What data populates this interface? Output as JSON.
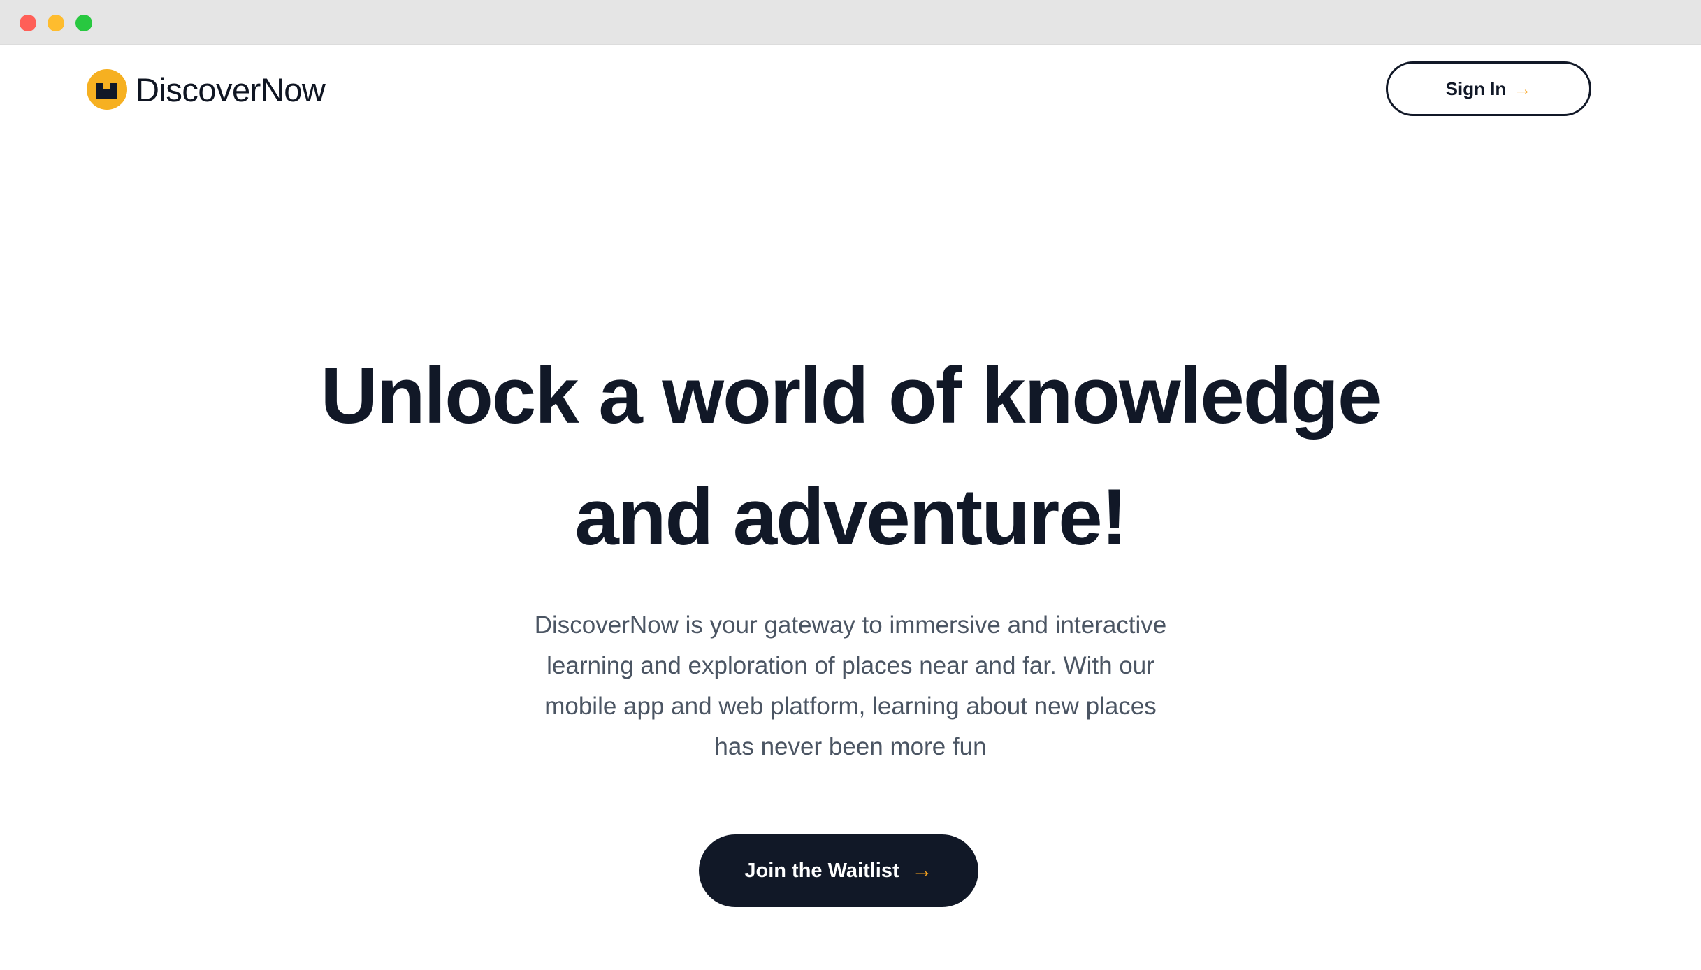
{
  "window": {
    "controls": [
      "close",
      "minimize",
      "maximize"
    ]
  },
  "header": {
    "logo_text": "DiscoverNow",
    "logo_icon": "discovernow-logo-icon",
    "signin_label": "Sign In",
    "signin_arrow": "→"
  },
  "hero": {
    "headline_lines": [
      "Unlock a world of knowledge",
      "and adventure!"
    ],
    "subtext_lines": [
      "DiscoverNow is your gateway to immersive and interactive",
      "learning and exploration of places near and far. With our",
      "mobile app and web platform, learning about new places",
      "has never been more fun"
    ],
    "cta_label": "Join the Waitlist",
    "cta_arrow": "→"
  },
  "colors": {
    "accent": "#f6a21e",
    "text_dark": "#111827",
    "text_muted": "#4b5563",
    "background": "#ffffff"
  }
}
